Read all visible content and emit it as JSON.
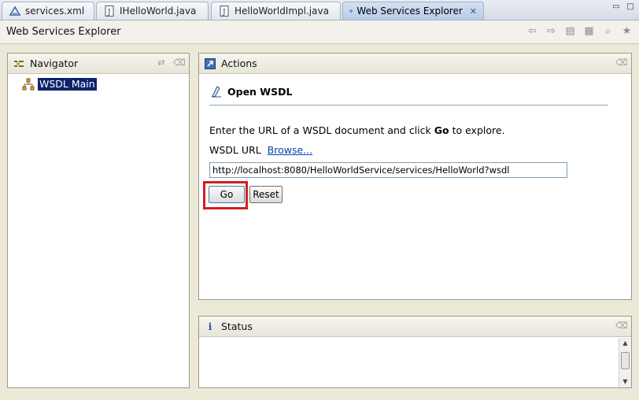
{
  "tabs": [
    {
      "label": "services.xml",
      "icon": "xml-file-icon",
      "active": false
    },
    {
      "label": "IHelloWorld.java",
      "icon": "java-file-icon",
      "active": false
    },
    {
      "label": "HelloWorldImpl.java",
      "icon": "java-file-icon",
      "active": false
    },
    {
      "label": "Web Services Explorer",
      "icon": "globe-icon",
      "active": true
    }
  ],
  "window": {
    "title": "Web Services Explorer"
  },
  "navigator": {
    "title": "Navigator",
    "items": [
      {
        "label": "WSDL Main",
        "selected": true
      }
    ]
  },
  "actions": {
    "title": "Actions",
    "section_title": "Open WSDL",
    "instruction_before": "Enter the URL of a WSDL document and click ",
    "instruction_bold": "Go",
    "instruction_after": " to explore.",
    "url_label": "WSDL URL",
    "browse_link": "Browse...",
    "url_value": "http://localhost:8080/HelloWorldService/services/HelloWorld?wsdl",
    "go_label": "Go",
    "reset_label": "Reset"
  },
  "status": {
    "title": "Status"
  },
  "colors": {
    "selection": "#0a246a",
    "highlight_box": "#d21f1f",
    "link": "#0645ad"
  }
}
